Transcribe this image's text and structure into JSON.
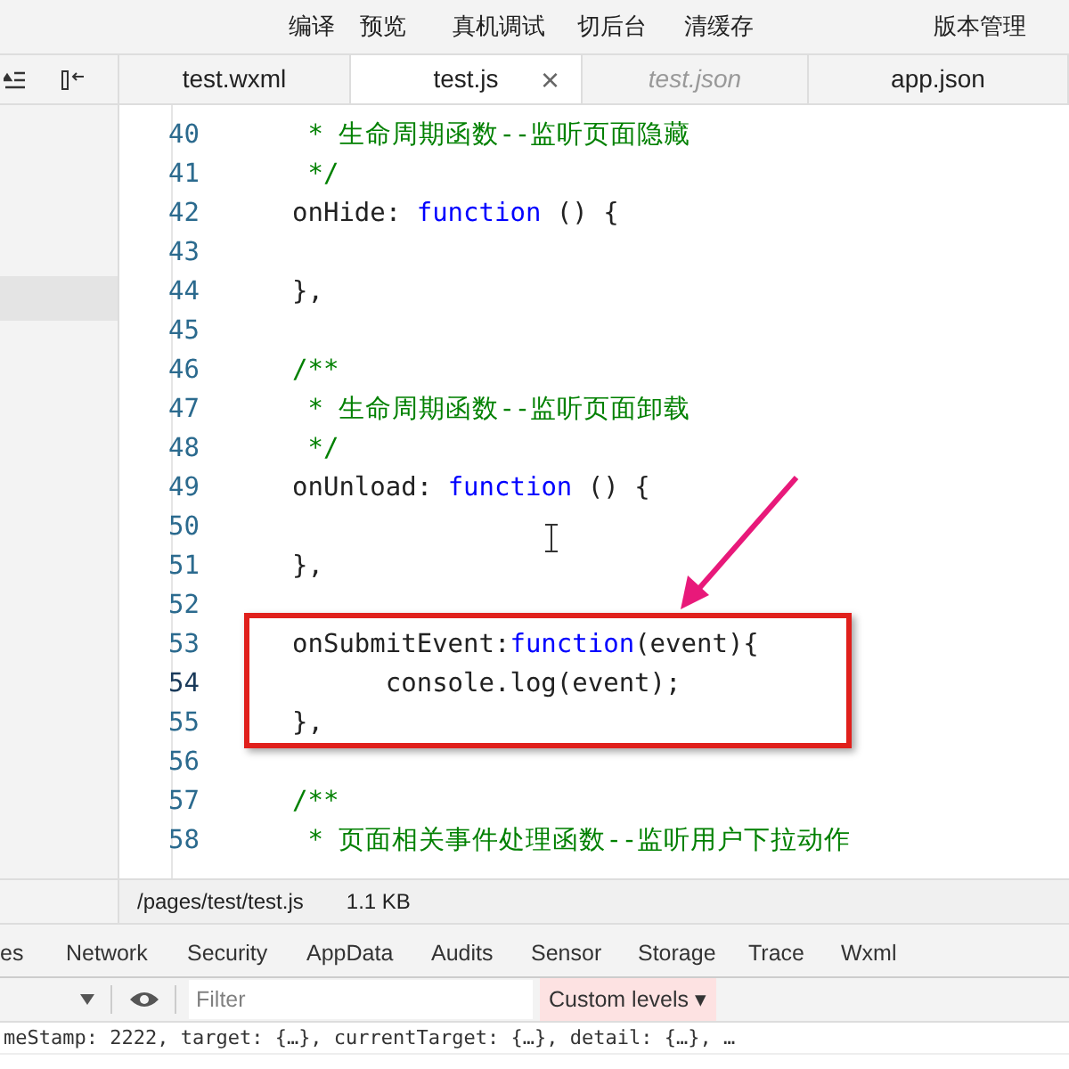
{
  "toolbar": {
    "buttons": [
      "编译",
      "预览",
      "真机调试",
      "切后台",
      "清缓存",
      "版本管理"
    ]
  },
  "editor_tabs": [
    {
      "label": "test.wxml",
      "selected": false,
      "preview": false
    },
    {
      "label": "test.js",
      "selected": true,
      "preview": false,
      "close": "×"
    },
    {
      "label": "test.json",
      "selected": false,
      "preview": true
    },
    {
      "label": "app.json",
      "selected": false,
      "preview": false
    }
  ],
  "editor": {
    "lines": [
      {
        "number": "40",
        "current": false,
        "tokens": [
          {
            "kind": "comment",
            "text": " * 生命周期函数--监听页面隐藏"
          }
        ]
      },
      {
        "number": "41",
        "current": false,
        "tokens": [
          {
            "kind": "comment",
            "text": " */"
          }
        ]
      },
      {
        "number": "42",
        "current": false,
        "tokens": [
          {
            "kind": "plain",
            "text": "onHide: "
          },
          {
            "kind": "keyword",
            "text": "function"
          },
          {
            "kind": "plain",
            "text": " () {"
          }
        ]
      },
      {
        "number": "43",
        "current": false
      },
      {
        "number": "44",
        "current": false,
        "tokens": [
          {
            "kind": "plain",
            "text": "},"
          }
        ]
      },
      {
        "number": "45",
        "current": false
      },
      {
        "number": "46",
        "current": false,
        "tokens": [
          {
            "kind": "comment",
            "text": "/**"
          }
        ]
      },
      {
        "number": "47",
        "current": false,
        "tokens": [
          {
            "kind": "comment",
            "text": " * 生命周期函数--监听页面卸载"
          }
        ]
      },
      {
        "number": "48",
        "current": false,
        "tokens": [
          {
            "kind": "comment",
            "text": " */"
          }
        ]
      },
      {
        "number": "49",
        "current": false,
        "tokens": [
          {
            "kind": "plain",
            "text": "onUnload: "
          },
          {
            "kind": "keyword",
            "text": "function"
          },
          {
            "kind": "plain",
            "text": " () {"
          }
        ]
      },
      {
        "number": "50",
        "current": false
      },
      {
        "number": "51",
        "current": false,
        "tokens": [
          {
            "kind": "plain",
            "text": "},"
          }
        ]
      },
      {
        "number": "52",
        "current": false
      },
      {
        "number": "53",
        "current": false,
        "tokens": [
          {
            "kind": "plain",
            "text": "onSubmitEvent:"
          },
          {
            "kind": "keyword",
            "text": "function"
          },
          {
            "kind": "plain",
            "text": "(event){"
          }
        ]
      },
      {
        "number": "54",
        "current": true,
        "tokens": [
          {
            "kind": "plain",
            "text": "      console.log(event);"
          }
        ]
      },
      {
        "number": "55",
        "current": false,
        "tokens": [
          {
            "kind": "plain",
            "text": "},"
          }
        ]
      },
      {
        "number": "56",
        "current": false
      },
      {
        "number": "57",
        "current": false,
        "tokens": [
          {
            "kind": "comment",
            "text": "/**"
          }
        ]
      },
      {
        "number": "58",
        "current": false,
        "tokens": [
          {
            "kind": "comment",
            "text": " * 页面相关事件处理函数--监听用户下拉动作"
          }
        ]
      }
    ]
  },
  "status_bar": {
    "path": "/pages/test/test.js",
    "size": "1.1 KB"
  },
  "devtools_tabs": [
    "es",
    "Network",
    "Security",
    "AppData",
    "Audits",
    "Sensor",
    "Storage",
    "Trace",
    "Wxml"
  ],
  "console": {
    "filter_placeholder": "Filter",
    "levels": "Custom levels ▾",
    "output": "meStamp: 2222, target: {…}, currentTarget: {…}, detail: {…}, …"
  }
}
